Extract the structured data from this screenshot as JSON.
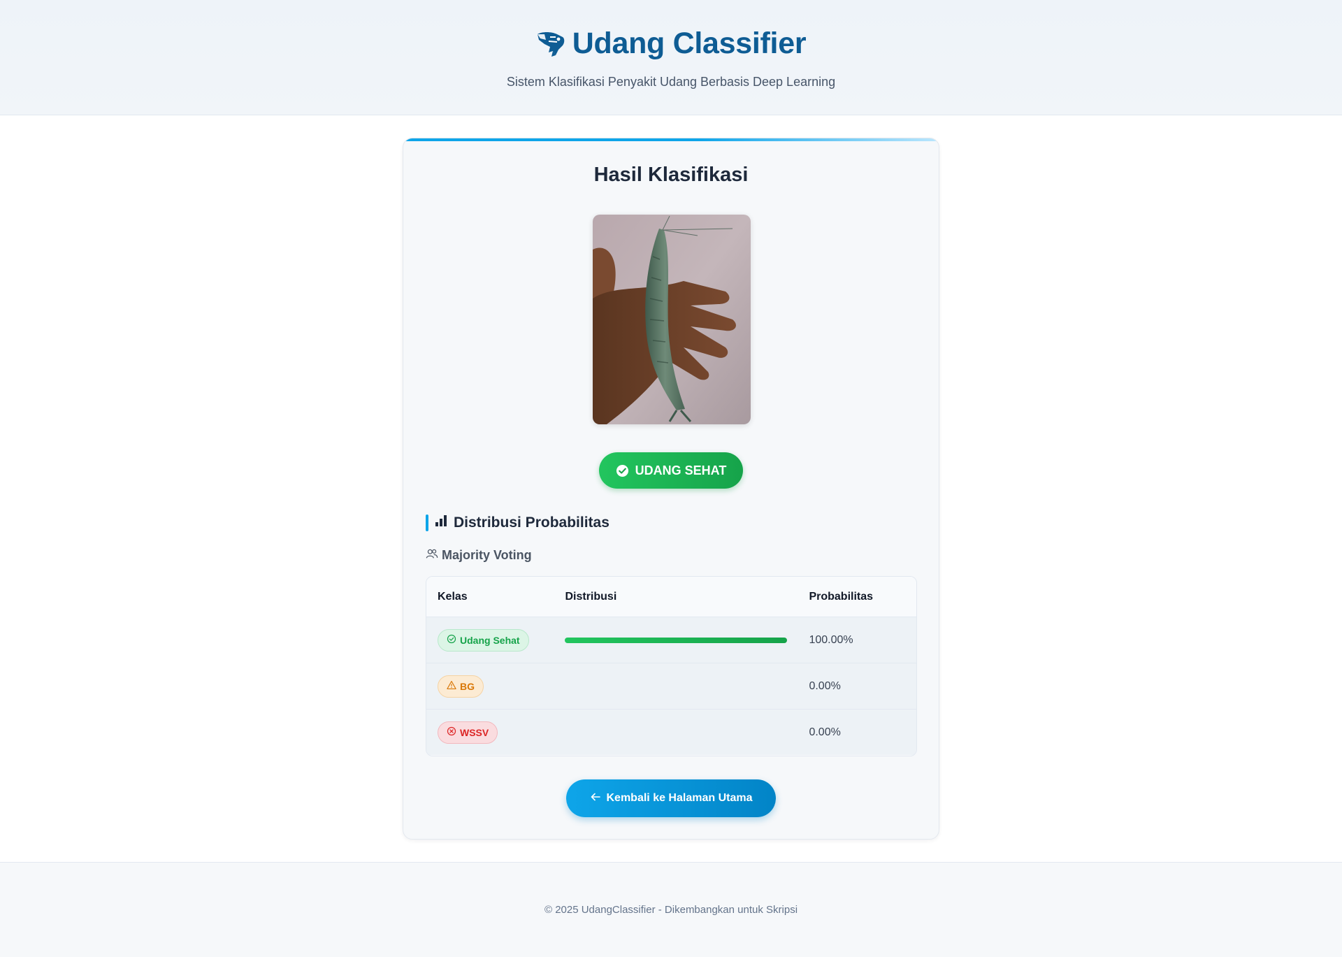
{
  "header": {
    "title": "Udang Classifier",
    "subtitle": "Sistem Klasifikasi Penyakit Udang Berbasis Deep Learning",
    "logo_icon": "shrimp-icon",
    "accent_color": "#0e5c94"
  },
  "result": {
    "title": "Hasil Klasifikasi",
    "image_subject": "shrimp-photo",
    "prediction_label": "UDANG SEHAT",
    "prediction_color": "#22c55e",
    "prediction_icon": "check-circle-icon"
  },
  "distribution": {
    "title": "Distribusi Probabilitas",
    "title_icon": "bar-chart-icon",
    "method_label": "Majority Voting",
    "method_icon": "users-icon",
    "columns": [
      "Kelas",
      "Distribusi",
      "Probabilitas"
    ],
    "rows": [
      {
        "label": "Udang Sehat",
        "icon": "check-circle-icon",
        "color": "#16a34a",
        "fraction": 1.0,
        "prob_text": "100.00%"
      },
      {
        "label": "BG",
        "icon": "warning-triangle-icon",
        "color": "#d97706",
        "fraction": 0.0,
        "prob_text": "0.00%"
      },
      {
        "label": "WSSV",
        "icon": "x-circle-icon",
        "color": "#dc2626",
        "fraction": 0.0,
        "prob_text": "0.00%"
      }
    ]
  },
  "actions": {
    "back_label": "Kembali ke Halaman Utama",
    "back_icon": "arrow-left-icon"
  },
  "footer": {
    "text": "© 2025 UdangClassifier - Dikembangkan untuk Skripsi"
  }
}
